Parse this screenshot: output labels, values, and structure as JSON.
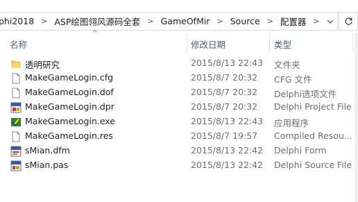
{
  "address": {
    "crumbs": [
      "phi2018",
      "ASP绘图翎风源码全套",
      "GameOfMir",
      "Source",
      "配置器"
    ],
    "separator": ">",
    "dropdown": "⌄",
    "refresh": "↻"
  },
  "columns": {
    "name": "名称",
    "date": "修改日期",
    "type": "类型",
    "sort_indicator": "^"
  },
  "files": [
    {
      "name": "透明研究",
      "date": "2015/8/13 22:43",
      "type": "文件夹",
      "icon": "folder-icon"
    },
    {
      "name": "MakeGameLogin.cfg",
      "date": "2015/8/7 20:32",
      "type": "CFG 文件",
      "icon": "file-icon"
    },
    {
      "name": "MakeGameLogin.dof",
      "date": "2015/8/7 20:32",
      "type": "Delphi选项文件",
      "icon": "file-icon"
    },
    {
      "name": "MakeGameLogin.dpr",
      "date": "2015/8/7 20:32",
      "type": "Delphi Project File",
      "icon": "delphi-project-icon"
    },
    {
      "name": "MakeGameLogin.exe",
      "date": "2015/8/13 22:43",
      "type": "应用程序",
      "icon": "exe-icon"
    },
    {
      "name": "MakeGameLogin.res",
      "date": "2015/8/7 19:57",
      "type": "Compiled Resou...",
      "icon": "file-icon"
    },
    {
      "name": "sMian.dfm",
      "date": "2015/8/13 22:42",
      "type": "Delphi Form",
      "icon": "delphi-form-icon"
    },
    {
      "name": "sMian.pas",
      "date": "2015/8/13 22:42",
      "type": "Delphi Source File",
      "icon": "delphi-source-icon"
    }
  ]
}
